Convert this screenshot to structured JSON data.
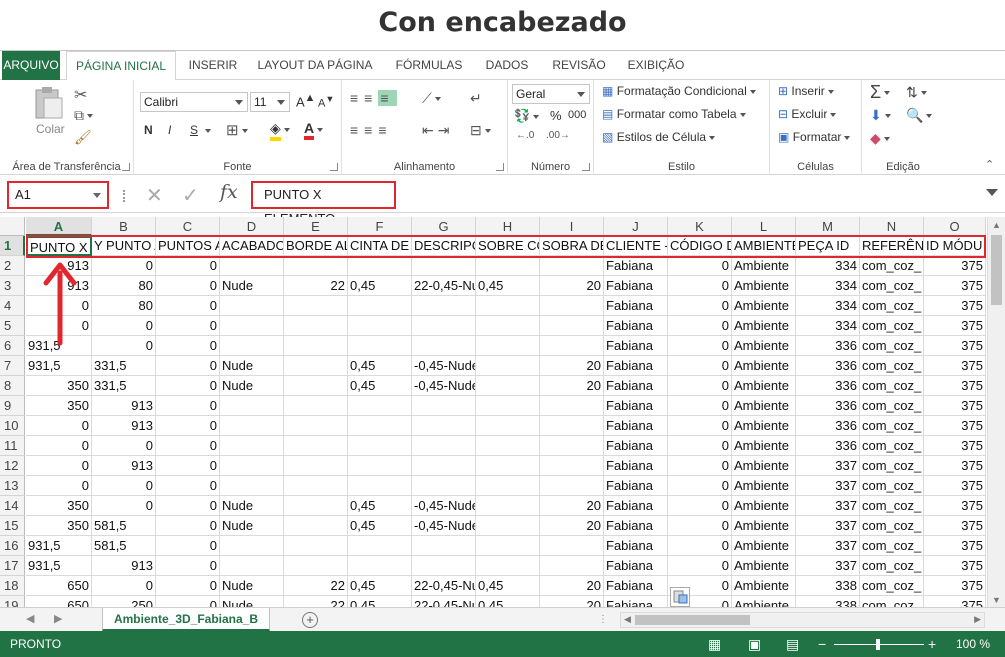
{
  "title": "Con encabezado",
  "ribbon_tabs": [
    "ARQUIVO",
    "PÁGINA INICIAL",
    "INSERIR",
    "LAYOUT DA PÁGINA",
    "FÓRMULAS",
    "DADOS",
    "REVISÃO",
    "EXIBIÇÃO"
  ],
  "clipboard": {
    "paste_label": "Colar",
    "group_label": "Área de Transferência"
  },
  "font": {
    "name": "Calibri",
    "size": "11",
    "group_label": "Fonte",
    "bold": "N",
    "italic": "I",
    "underline": "S"
  },
  "alignment": {
    "group_label": "Alinhamento"
  },
  "number": {
    "format": "Geral",
    "percent": "%",
    "thousands": "000",
    "group_label": "Número"
  },
  "styles": {
    "conditional": "Formatação Condicional",
    "as_table": "Formatar como Tabela",
    "cell_styles": "Estilos de Célula",
    "group_label": "Estilo"
  },
  "cells": {
    "insert": "Inserir",
    "delete": "Excluir",
    "format": "Formatar",
    "group_label": "Células"
  },
  "editing": {
    "group_label": "Edição"
  },
  "formula_bar": {
    "name_box": "A1",
    "fx": "fx",
    "content": "PUNTO X ELEMENTO"
  },
  "columns": [
    "A",
    "B",
    "C",
    "D",
    "E",
    "F",
    "G",
    "H",
    "I",
    "J",
    "K",
    "L",
    "M",
    "N",
    "O"
  ],
  "header_row": [
    "PUNTO X I",
    "Y PUNTO A",
    "PUNTOS A",
    "ACABADO",
    "BORDE AL",
    "CINTA DE",
    "DESCRIPCI",
    "SOBRE CO",
    "SOBRA DE",
    "CLIENTE -",
    "CÓDIGO D",
    "AMBIENTE",
    "PEÇA ID",
    "REFERÊNC",
    "ID MÓDU"
  ],
  "rows": [
    {
      "n": "2",
      "c": [
        "913",
        "0",
        "0",
        "",
        "",
        "",
        "",
        "",
        "",
        "Fabiana",
        "0",
        "Ambiente",
        "334",
        "com_coz_",
        "375"
      ]
    },
    {
      "n": "3",
      "c": [
        "913",
        "80",
        "0",
        "Nude",
        "22",
        "0,45",
        "22-0,45-Nu",
        "0,45",
        "20",
        "Fabiana",
        "0",
        "Ambiente",
        "334",
        "com_coz_",
        "375"
      ]
    },
    {
      "n": "4",
      "c": [
        "0",
        "80",
        "0",
        "",
        "",
        "",
        "",
        "",
        "",
        "Fabiana",
        "0",
        "Ambiente",
        "334",
        "com_coz_",
        "375"
      ]
    },
    {
      "n": "5",
      "c": [
        "0",
        "0",
        "0",
        "",
        "",
        "",
        "",
        "",
        "",
        "Fabiana",
        "0",
        "Ambiente",
        "334",
        "com_coz_",
        "375"
      ]
    },
    {
      "n": "6",
      "c": [
        "931,5",
        "0",
        "0",
        "",
        "",
        "",
        "",
        "",
        "",
        "Fabiana",
        "0",
        "Ambiente",
        "336",
        "com_coz_",
        "375"
      ]
    },
    {
      "n": "7",
      "c": [
        "931,5",
        "331,5",
        "0",
        "Nude",
        "",
        "0,45",
        "-0,45-Nude",
        "",
        "20",
        "Fabiana",
        "0",
        "Ambiente",
        "336",
        "com_coz_",
        "375"
      ]
    },
    {
      "n": "8",
      "c": [
        "350",
        "331,5",
        "0",
        "Nude",
        "",
        "0,45",
        "-0,45-Nude",
        "",
        "20",
        "Fabiana",
        "0",
        "Ambiente",
        "336",
        "com_coz_",
        "375"
      ]
    },
    {
      "n": "9",
      "c": [
        "350",
        "913",
        "0",
        "",
        "",
        "",
        "",
        "",
        "",
        "Fabiana",
        "0",
        "Ambiente",
        "336",
        "com_coz_",
        "375"
      ]
    },
    {
      "n": "10",
      "c": [
        "0",
        "913",
        "0",
        "",
        "",
        "",
        "",
        "",
        "",
        "Fabiana",
        "0",
        "Ambiente",
        "336",
        "com_coz_",
        "375"
      ]
    },
    {
      "n": "11",
      "c": [
        "0",
        "0",
        "0",
        "",
        "",
        "",
        "",
        "",
        "",
        "Fabiana",
        "0",
        "Ambiente",
        "336",
        "com_coz_",
        "375"
      ]
    },
    {
      "n": "12",
      "c": [
        "0",
        "913",
        "0",
        "",
        "",
        "",
        "",
        "",
        "",
        "Fabiana",
        "0",
        "Ambiente",
        "337",
        "com_coz_",
        "375"
      ]
    },
    {
      "n": "13",
      "c": [
        "0",
        "0",
        "0",
        "",
        "",
        "",
        "",
        "",
        "",
        "Fabiana",
        "0",
        "Ambiente",
        "337",
        "com_coz_",
        "375"
      ]
    },
    {
      "n": "14",
      "c": [
        "350",
        "0",
        "0",
        "Nude",
        "",
        "0,45",
        "-0,45-Nude",
        "",
        "20",
        "Fabiana",
        "0",
        "Ambiente",
        "337",
        "com_coz_",
        "375"
      ]
    },
    {
      "n": "15",
      "c": [
        "350",
        "581,5",
        "0",
        "Nude",
        "",
        "0,45",
        "-0,45-Nude",
        "",
        "20",
        "Fabiana",
        "0",
        "Ambiente",
        "337",
        "com_coz_",
        "375"
      ]
    },
    {
      "n": "16",
      "c": [
        "931,5",
        "581,5",
        "0",
        "",
        "",
        "",
        "",
        "",
        "",
        "Fabiana",
        "0",
        "Ambiente",
        "337",
        "com_coz_",
        "375"
      ]
    },
    {
      "n": "17",
      "c": [
        "931,5",
        "913",
        "0",
        "",
        "",
        "",
        "",
        "",
        "",
        "Fabiana",
        "0",
        "Ambiente",
        "337",
        "com_coz_",
        "375"
      ]
    },
    {
      "n": "18",
      "c": [
        "650",
        "0",
        "0",
        "Nude",
        "22",
        "0,45",
        "22-0,45-Nu",
        "0,45",
        "20",
        "Fabiana",
        "0",
        "Ambiente",
        "338",
        "com_coz_",
        "375"
      ]
    },
    {
      "n": "19",
      "c": [
        "650",
        "250",
        "0",
        "Nude",
        "22",
        "0,45",
        "22-0,45-Nu",
        "0,45",
        "20",
        "Fabiana",
        "0",
        "Ambiente",
        "338",
        "com_coz_",
        "375"
      ]
    }
  ],
  "sheet_tab": "Ambiente_3D_Fabiana_B",
  "status": {
    "mode": "PRONTO",
    "zoom": "100 %"
  },
  "colors": {
    "accent": "#217346",
    "highlight": "#e0262f"
  }
}
